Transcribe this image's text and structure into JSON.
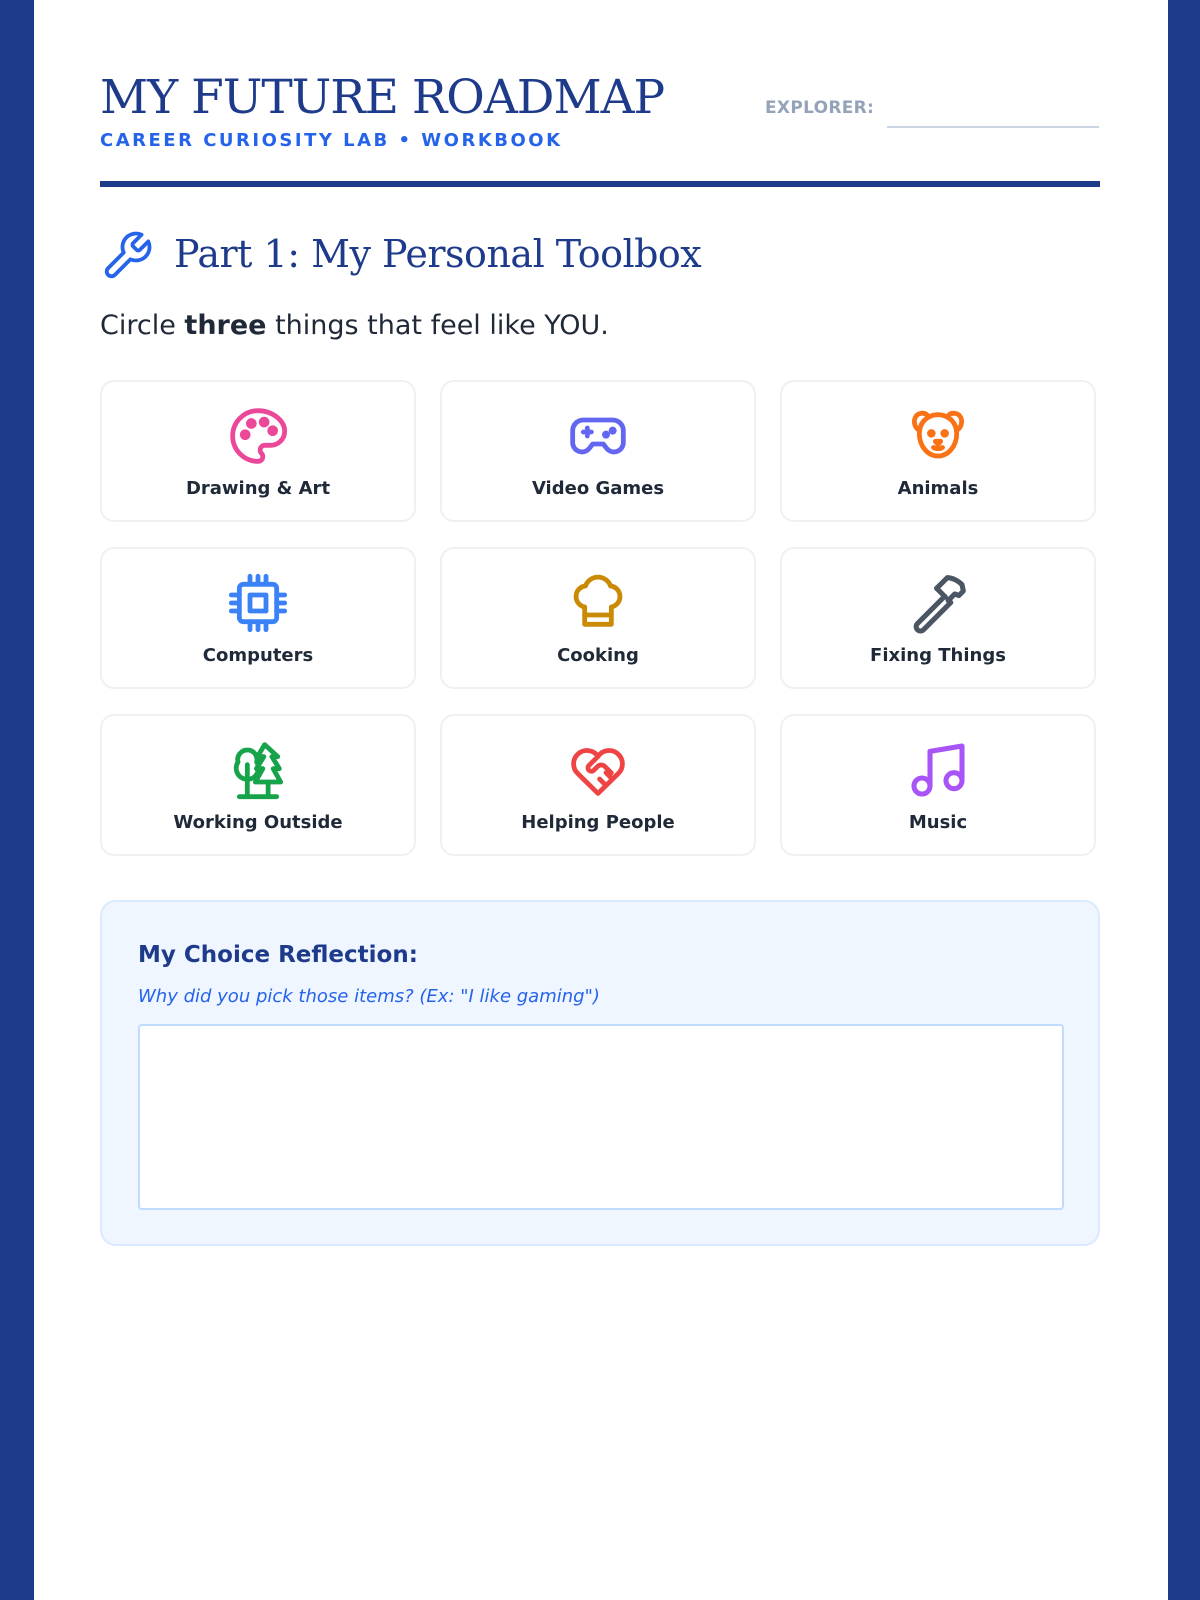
{
  "header": {
    "title": "MY FUTURE ROADMAP",
    "subtitle": "CAREER CURIOSITY LAB • WORKBOOK",
    "explorer_label": "EXPLORER:",
    "explorer_value": ""
  },
  "part": {
    "icon": "wrench-icon",
    "title": "Part 1: My Personal Toolbox"
  },
  "instruction": {
    "before": "Circle ",
    "bold": "three",
    "after": " things that feel like YOU."
  },
  "interests": [
    {
      "label": "Drawing & Art",
      "icon": "palette-icon",
      "color": "#ec4899"
    },
    {
      "label": "Video Games",
      "icon": "gamepad-icon",
      "color": "#6366f1"
    },
    {
      "label": "Animals",
      "icon": "dog-icon",
      "color": "#f97316"
    },
    {
      "label": "Computers",
      "icon": "cpu-chip-icon",
      "color": "#3b82f6"
    },
    {
      "label": "Cooking",
      "icon": "chef-hat-icon",
      "color": "#ca8a04"
    },
    {
      "label": "Fixing Things",
      "icon": "hammer-icon",
      "color": "#4b5563"
    },
    {
      "label": "Working Outside",
      "icon": "trees-icon",
      "color": "#16a34a"
    },
    {
      "label": "Helping People",
      "icon": "heart-handshake-icon",
      "color": "#ef4444"
    },
    {
      "label": "Music",
      "icon": "music-note-icon",
      "color": "#a855f7"
    }
  ],
  "reflection": {
    "title": "My Choice Reflection:",
    "hint": "Why did you pick those items? (Ex: \"I like gaming\")",
    "answer": ""
  },
  "colors": {
    "navy": "#1e3a8a",
    "accent_blue": "#2563eb",
    "panel_bg": "#eff6ff"
  }
}
